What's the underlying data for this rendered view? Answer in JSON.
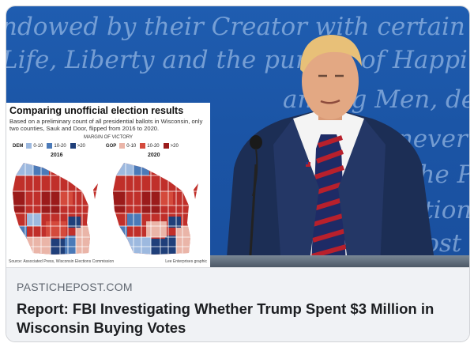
{
  "background_text": {
    "line1": "ndowed by their Creator with certain unalienab",
    "line2": "Life, Liberty and the pursuit of Happiness.",
    "line3": "among Men, deriv",
    "line4": "whenever any",
    "line5": "of the Peop",
    "line6": "dation on",
    "line7": "n most li"
  },
  "inset": {
    "title": "Comparing unofficial election results",
    "subtitle": "Based on a preliminary count of all presidential ballots in Wisconsin, only two counties, Sauk and Door, flipped from 2016 to 2020.",
    "legend_title": "MARGIN OF VICTORY",
    "dem_label": "DEM",
    "gop_label": "GOP",
    "ranges": [
      "0-10",
      "10-20",
      ">20"
    ],
    "year_a": "2016",
    "year_b": "2020",
    "source": "Source: Associated Press, Wisconsin Elections Commission",
    "credit": "Lee Enterprises graphic",
    "colors": {
      "dem": [
        "#9db9df",
        "#4b7ab8",
        "#1f3f7a"
      ],
      "gop": [
        "#eab5a8",
        "#d44a3c",
        "#9b1b1b"
      ]
    }
  },
  "link_preview": {
    "domain": "PASTICHEPOST.COM",
    "headline": "Report: FBI Investigating Whether Trump Spent $3 Million in Wisconsin Buying Votes"
  }
}
